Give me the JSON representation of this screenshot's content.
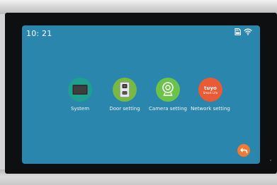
{
  "status_bar": {
    "time": "10: 21",
    "icons": [
      "sd-card-icon",
      "wifi-icon"
    ]
  },
  "menu": {
    "items": [
      {
        "label": "System",
        "icon": "monitor-icon",
        "color": "#1f9f8f"
      },
      {
        "label": "Door setting",
        "icon": "door-station-icon",
        "color": "#78b943"
      },
      {
        "label": "Camera setting",
        "icon": "camera-icon",
        "color": "#6cc34a"
      },
      {
        "label": "Network setting",
        "icon": "tuya-smart-life-icon",
        "color": "#ea5a35",
        "logo_text": "tuyo",
        "logo_subtext": "Smart Life"
      }
    ]
  },
  "back_button": {
    "icon": "back-arrow-icon",
    "color": "#ee7a34"
  },
  "colors": {
    "screen_bg": "#2a86ac",
    "bezel": "#0e0f10"
  }
}
